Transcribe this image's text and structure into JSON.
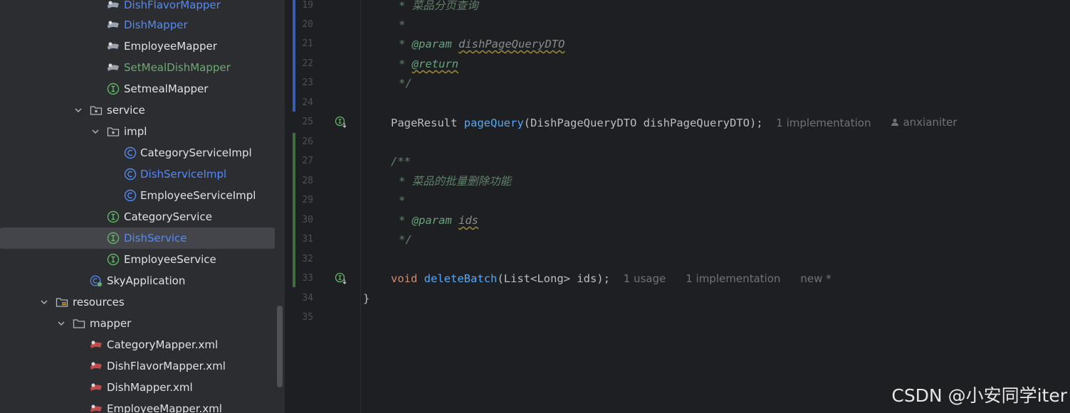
{
  "project_tree": {
    "items": [
      {
        "label": "DishFlavorMapper",
        "icon": "mapper-icon",
        "status": "modified"
      },
      {
        "label": "DishMapper",
        "icon": "mapper-icon",
        "status": "modified"
      },
      {
        "label": "EmployeeMapper",
        "icon": "mapper-icon",
        "status": "default"
      },
      {
        "label": "SetMealDishMapper",
        "icon": "mapper-icon",
        "status": "added"
      },
      {
        "label": "SetmealMapper",
        "icon": "interface-icon",
        "status": "default"
      },
      {
        "label": "service",
        "icon": "package-folder-icon",
        "status": "default",
        "expanded": true
      },
      {
        "label": "impl",
        "icon": "package-folder-icon",
        "status": "default",
        "expanded": true
      },
      {
        "label": "CategoryServiceImpl",
        "icon": "class-icon",
        "status": "default"
      },
      {
        "label": "DishServiceImpl",
        "icon": "class-icon",
        "status": "modified"
      },
      {
        "label": "EmployeeServiceImpl",
        "icon": "class-icon",
        "status": "default"
      },
      {
        "label": "CategoryService",
        "icon": "interface-icon",
        "status": "default"
      },
      {
        "label": "DishService",
        "icon": "interface-icon",
        "status": "modified",
        "selected": true
      },
      {
        "label": "EmployeeService",
        "icon": "interface-icon",
        "status": "default"
      },
      {
        "label": "SkyApplication",
        "icon": "spring-class-icon",
        "status": "default"
      },
      {
        "label": "resources",
        "icon": "resources-folder-icon",
        "status": "default",
        "expanded": true
      },
      {
        "label": "mapper",
        "icon": "folder-icon",
        "status": "default",
        "expanded": true
      },
      {
        "label": "CategoryMapper.xml",
        "icon": "mybatis-xml-icon",
        "status": "default"
      },
      {
        "label": "DishFlavorMapper.xml",
        "icon": "mybatis-xml-icon",
        "status": "default"
      },
      {
        "label": "DishMapper.xml",
        "icon": "mybatis-xml-icon",
        "status": "default"
      },
      {
        "label": "EmployeeMapper.xml",
        "icon": "mybatis-xml-icon",
        "status": "default"
      }
    ]
  },
  "editor": {
    "line_numbers": [
      "19",
      "20",
      "21",
      "22",
      "23",
      "24",
      "25",
      "26",
      "27",
      "28",
      "29",
      "30",
      "31",
      "32",
      "33",
      "34",
      "35"
    ],
    "lines": {
      "l19": "* 菜品分页查询",
      "l20": "*",
      "l21_tag": "@param",
      "l21_arg": "dishPageQueryDTO",
      "l22_tag": "@return",
      "l23": "*/",
      "l25_type": "PageResult",
      "l25_fn": "pageQuery",
      "l25_rest": "(DishPageQueryDTO dishPageQueryDTO);",
      "l25_hint_impl": "1 implementation",
      "l25_hint_author": "anxianiter",
      "l27": "/**",
      "l28": "* 菜品的批量删除功能",
      "l29": "*",
      "l30_tag": "@param",
      "l30_arg": "ids",
      "l31": "*/",
      "l33_kw": "void",
      "l33_fn": "deleteBatch",
      "l33_rest": "(List<Long> ids);",
      "l33_hint_usage": "1 usage",
      "l33_hint_impl": "1 implementation",
      "l33_hint_new": "new *",
      "l34": "}"
    }
  },
  "watermark": "CSDN @小安同学iter",
  "colors": {
    "modified": "#548af7",
    "added": "#6aab73",
    "default": "#dfe1e5"
  }
}
